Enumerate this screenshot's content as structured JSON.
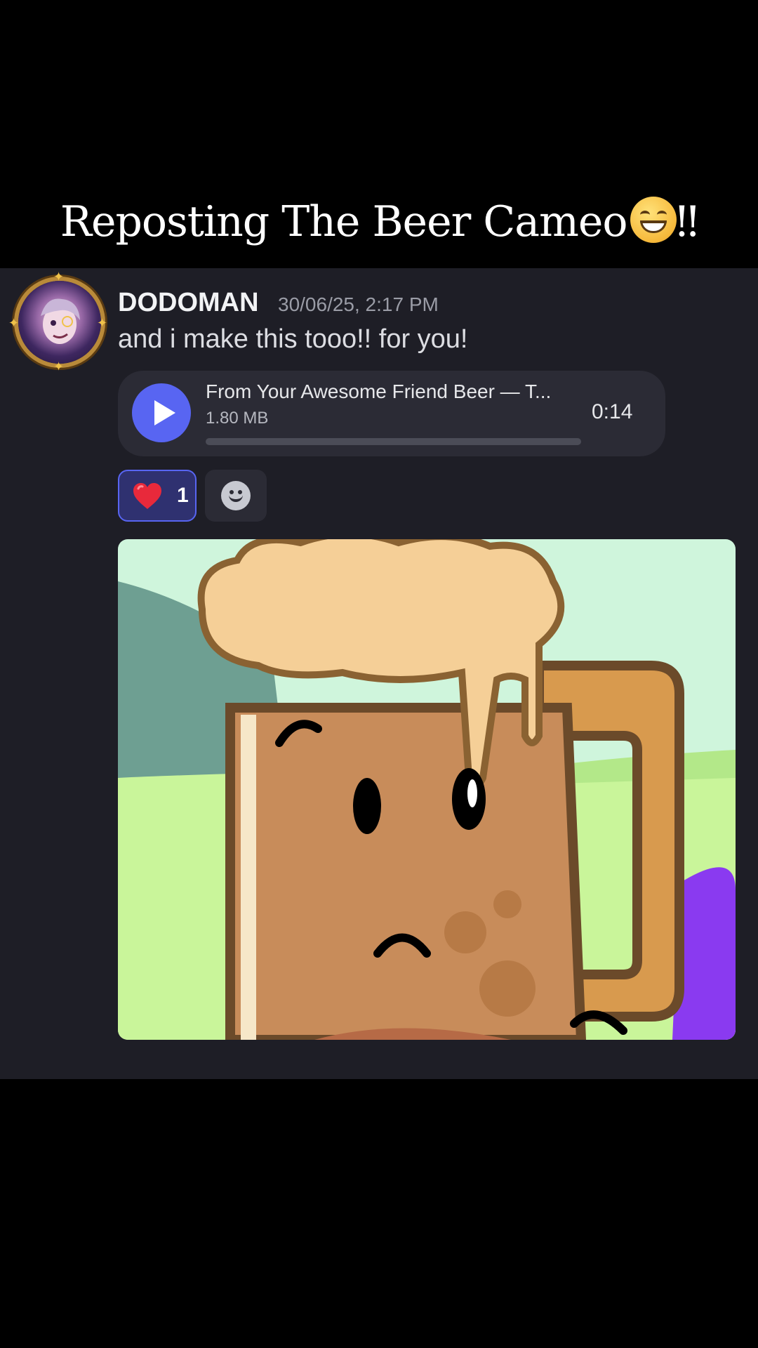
{
  "caption": {
    "text": "Reposting The Beer Cameo",
    "suffix": "‼"
  },
  "message": {
    "username": "DODOMAN",
    "timestamp": "30/06/25, 2:17 PM",
    "text": "and i make this tooo!! for you!"
  },
  "audio_attachment": {
    "title": "From Your Awesome Friend Beer — T...",
    "size": "1.80 MB",
    "duration": "0:14",
    "progress": 0
  },
  "reactions": [
    {
      "emoji": "heart-icon",
      "count": "1",
      "selected": true
    }
  ],
  "colors": {
    "panel": "#1e1e26",
    "accent": "#5865f2",
    "reaction_bg": "#2f3170"
  }
}
